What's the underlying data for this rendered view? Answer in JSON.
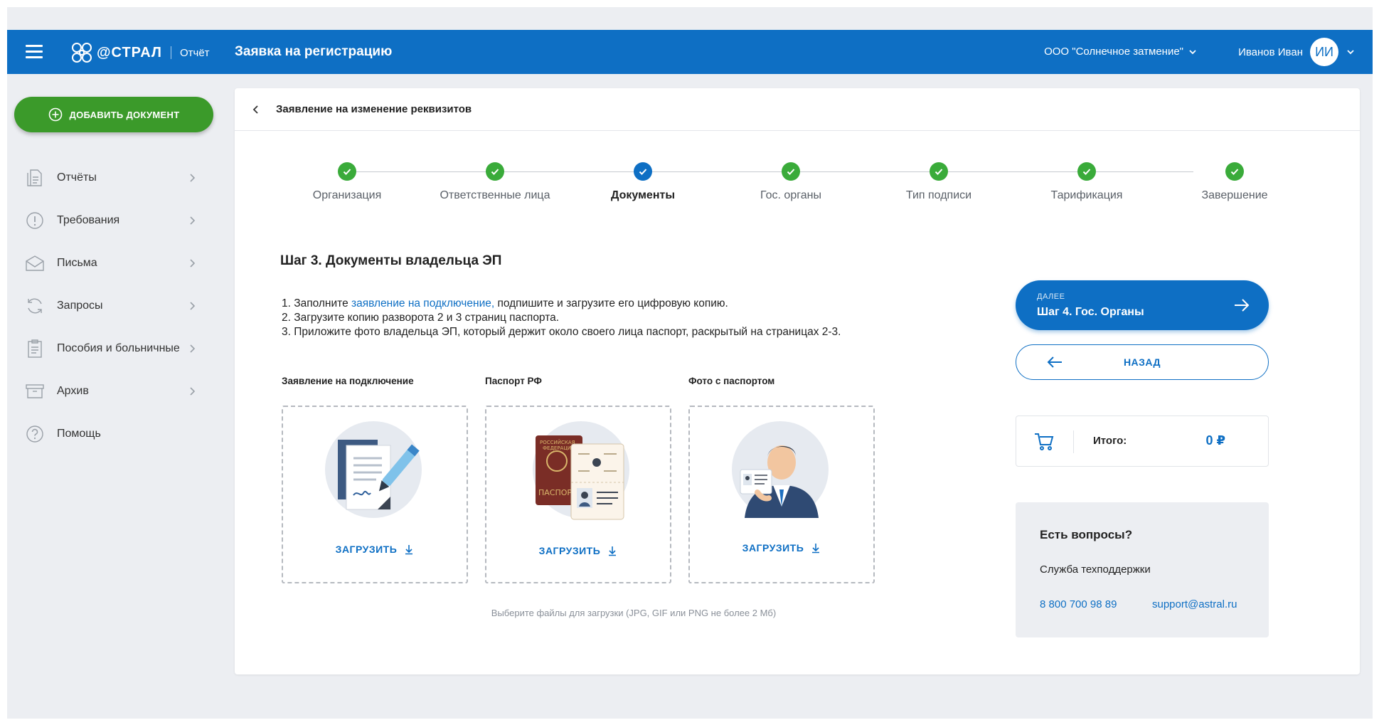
{
  "header": {
    "logo_text": "@СТРАЛ",
    "product": "Отчёт",
    "title": "Заявка на регистрацию",
    "organization": "ООО \"Солнечное затмение\"",
    "user_name": "Иванов Иван",
    "user_initials": "ИИ",
    "accent_color": "#0e6fc4"
  },
  "sidebar": {
    "add_button": "ДОБАВИТЬ ДОКУМЕНТ",
    "items": [
      {
        "label": "Отчёты",
        "icon": "report-icon"
      },
      {
        "label": "Требования",
        "icon": "exclamation-icon"
      },
      {
        "label": "Письма",
        "icon": "envelope-icon"
      },
      {
        "label": "Запросы",
        "icon": "refresh-icon"
      },
      {
        "label": "Пособия и больничные",
        "icon": "clipboard-icon"
      },
      {
        "label": "Архив",
        "icon": "archive-icon"
      },
      {
        "label": "Помощь",
        "icon": "question-icon"
      }
    ]
  },
  "card": {
    "title": "Заявление на изменение реквизитов"
  },
  "steps": [
    {
      "label": "Организация",
      "status": "done"
    },
    {
      "label": "Ответственные лица",
      "status": "done"
    },
    {
      "label": "Документы",
      "status": "active"
    },
    {
      "label": "Гос. органы",
      "status": "done"
    },
    {
      "label": "Тип подписи",
      "status": "done"
    },
    {
      "label": "Тарификация",
      "status": "done"
    },
    {
      "label": "Завершение",
      "status": "done"
    }
  ],
  "main": {
    "heading": "Шаг 3. Документы владельца ЭП",
    "line1_prefix": "1. Заполните ",
    "line1_link": "заявление на подключение,",
    "line1_suffix": " подпишите и загрузите его цифровую копию.",
    "line2": "2. Загрузите копию разворота 2 и 3 страниц паспорта.",
    "line3": "3. Приложите фото владельца ЭП, который держит около своего лица паспорт, раскрытый на страницах 2-3.",
    "uploads": [
      {
        "label": "Заявление на подключение",
        "action": "ЗАГРУЗИТЬ"
      },
      {
        "label": "Паспорт РФ",
        "action": "ЗАГРУЗИТЬ"
      },
      {
        "label": "Фото с паспортом",
        "action": "ЗАГРУЗИТЬ"
      }
    ],
    "hint": "Выберите файлы для загрузки (JPG, GIF или PNG не более 2 Мб)"
  },
  "side": {
    "next_small": "ДАЛЕЕ",
    "next_main": "Шаг 4. Гос. Органы",
    "back": "НАЗАД",
    "total_label": "Итого:",
    "total_value": "0 ₽",
    "help_title": "Есть вопросы?",
    "help_sub": "Служба техподдержки",
    "phone": "8 800 700 98 89",
    "email": "support@astral.ru"
  }
}
